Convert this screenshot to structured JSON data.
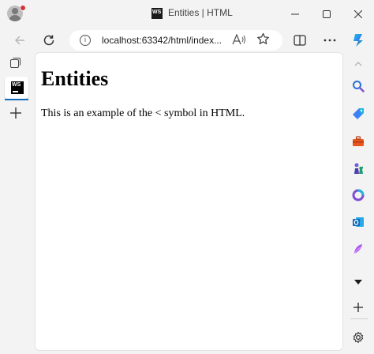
{
  "window": {
    "tab_title": "Entities | HTML",
    "favicon_text": "WS"
  },
  "toolbar": {
    "url": "localhost:63342/html/index..."
  },
  "page": {
    "heading": "Entities",
    "paragraph": "This is an example of the < symbol in HTML."
  },
  "icons": {
    "title_bar": [
      "profile-avatar-icon",
      "minimize-icon",
      "maximize-icon",
      "close-icon"
    ],
    "toolbar": [
      "back-arrow-icon",
      "refresh-icon",
      "info-icon",
      "read-aloud-icon",
      "favorite-star-icon",
      "split-screen-icon",
      "more-icon",
      "copilot-icon"
    ],
    "vertical_tabs": [
      "tab-actions-icon",
      "new-tab-plus-icon"
    ],
    "sidebar": [
      "search-icon",
      "shopping-tag-icon",
      "tools-briefcase-icon",
      "games-chess-icon",
      "microsoft-365-icon",
      "outlook-icon",
      "designer-icon",
      "chevron-down-icon",
      "add-icon",
      "settings-gear-icon"
    ]
  },
  "colors": {
    "accent": "#0f6cbd",
    "window_background": "#f3f3f3",
    "content_background": "#ffffff",
    "notification_dot": "#d13438"
  }
}
